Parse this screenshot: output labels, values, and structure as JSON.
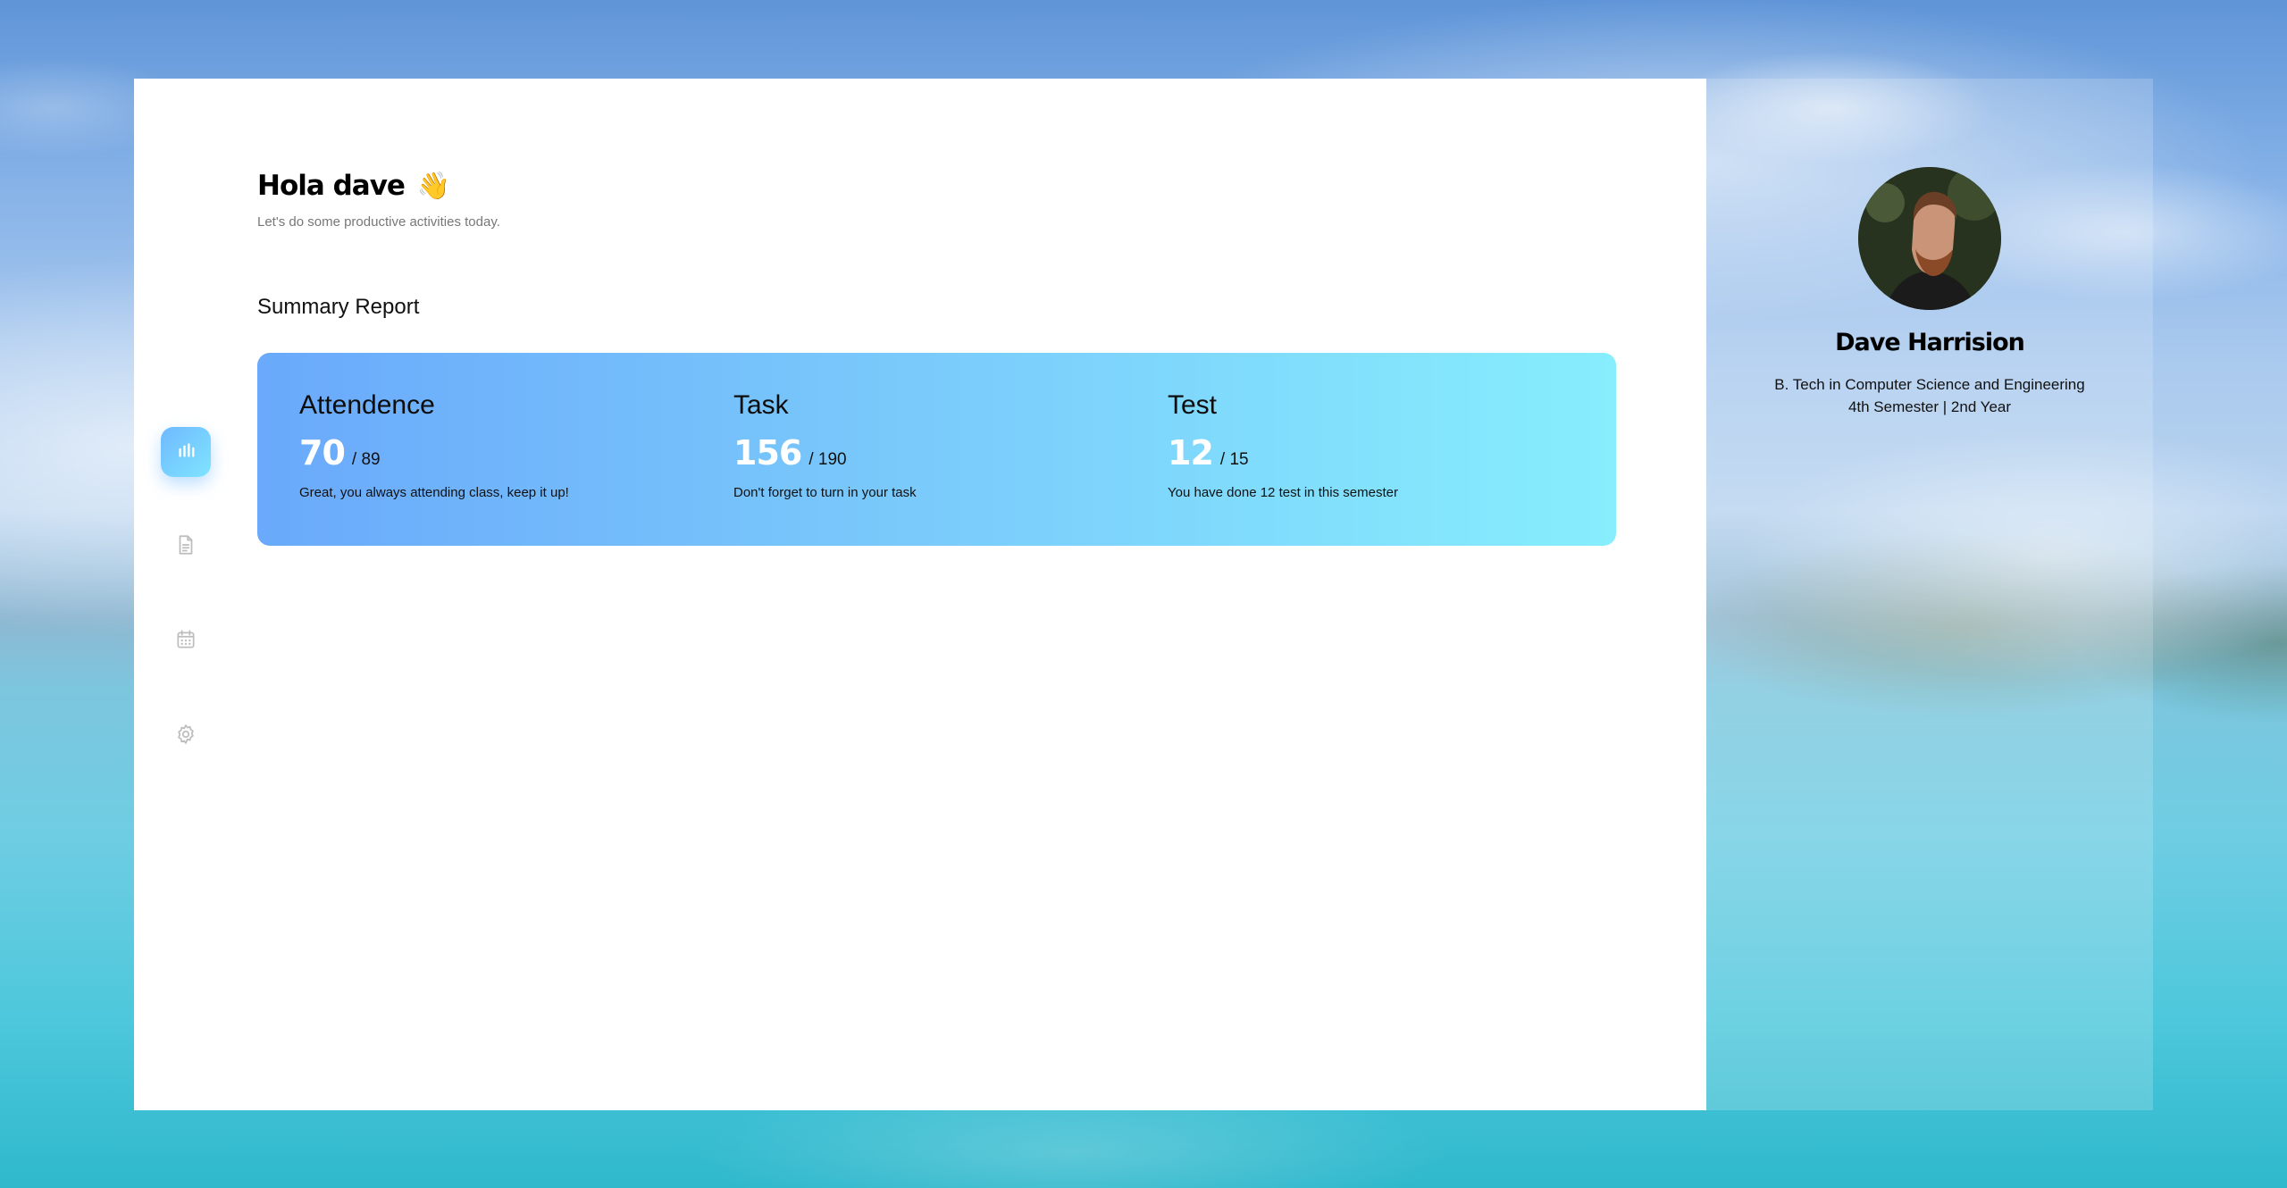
{
  "greeting": {
    "title": "Hola dave",
    "emoji": "👋",
    "subtitle": "Let's do some productive activities today."
  },
  "summary": {
    "title": "Summary Report",
    "metrics": [
      {
        "label": "Attendence",
        "value": "70",
        "total": "/ 89",
        "note": "Great, you always attending class, keep it up!"
      },
      {
        "label": "Task",
        "value": "156",
        "total": "/ 190",
        "note": "Don't forget to turn in your task"
      },
      {
        "label": "Test",
        "value": "12",
        "total": "/ 15",
        "note": "You have done 12 test in this semester"
      }
    ]
  },
  "sidebar": {
    "items": [
      {
        "icon": "bar-chart-icon",
        "active": true
      },
      {
        "icon": "document-icon",
        "active": false
      },
      {
        "icon": "calendar-icon",
        "active": false
      },
      {
        "icon": "gear-icon",
        "active": false
      }
    ]
  },
  "profile": {
    "name": "Dave Harrision",
    "degree": "B. Tech in Computer Science and Engineering",
    "year": "4th Semester | 2nd Year"
  },
  "colors": {
    "accent_start": "#6aa9fb",
    "accent_end": "#87eefd",
    "inactive_icon": "#bbbbbb"
  }
}
